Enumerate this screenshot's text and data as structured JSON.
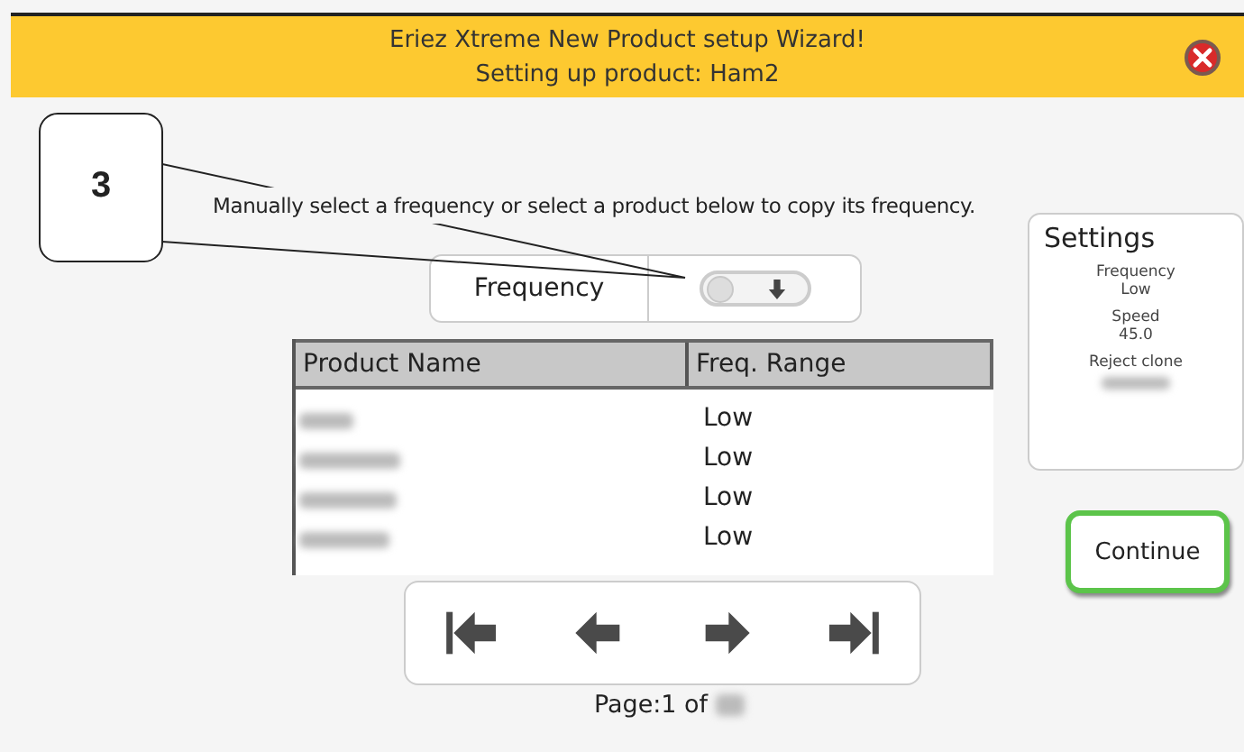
{
  "header": {
    "title": "Eriez Xtreme New Product setup Wizard!",
    "subtitle": "Setting up product: Ham2"
  },
  "callout": {
    "label": "3"
  },
  "instruction": "Manually select a frequency or select a product below to copy its frequency.",
  "frequency_control": {
    "label": "Frequency",
    "on": false
  },
  "table": {
    "columns": [
      "Product Name",
      "Freq. Range"
    ],
    "rows": [
      {
        "freq_range": "Low"
      },
      {
        "freq_range": "Low"
      },
      {
        "freq_range": "Low"
      },
      {
        "freq_range": "Low"
      }
    ]
  },
  "settings": {
    "title": "Settings",
    "items": [
      {
        "label": "Frequency",
        "value": "Low"
      },
      {
        "label": "Speed",
        "value": "45.0"
      },
      {
        "label": "Reject clone"
      }
    ]
  },
  "pager": {
    "buttons": [
      {
        "kind": "first"
      },
      {
        "kind": "prev"
      },
      {
        "kind": "next"
      },
      {
        "kind": "last"
      }
    ],
    "page_label": "Page:1 of"
  },
  "continue_button": "Continue"
}
